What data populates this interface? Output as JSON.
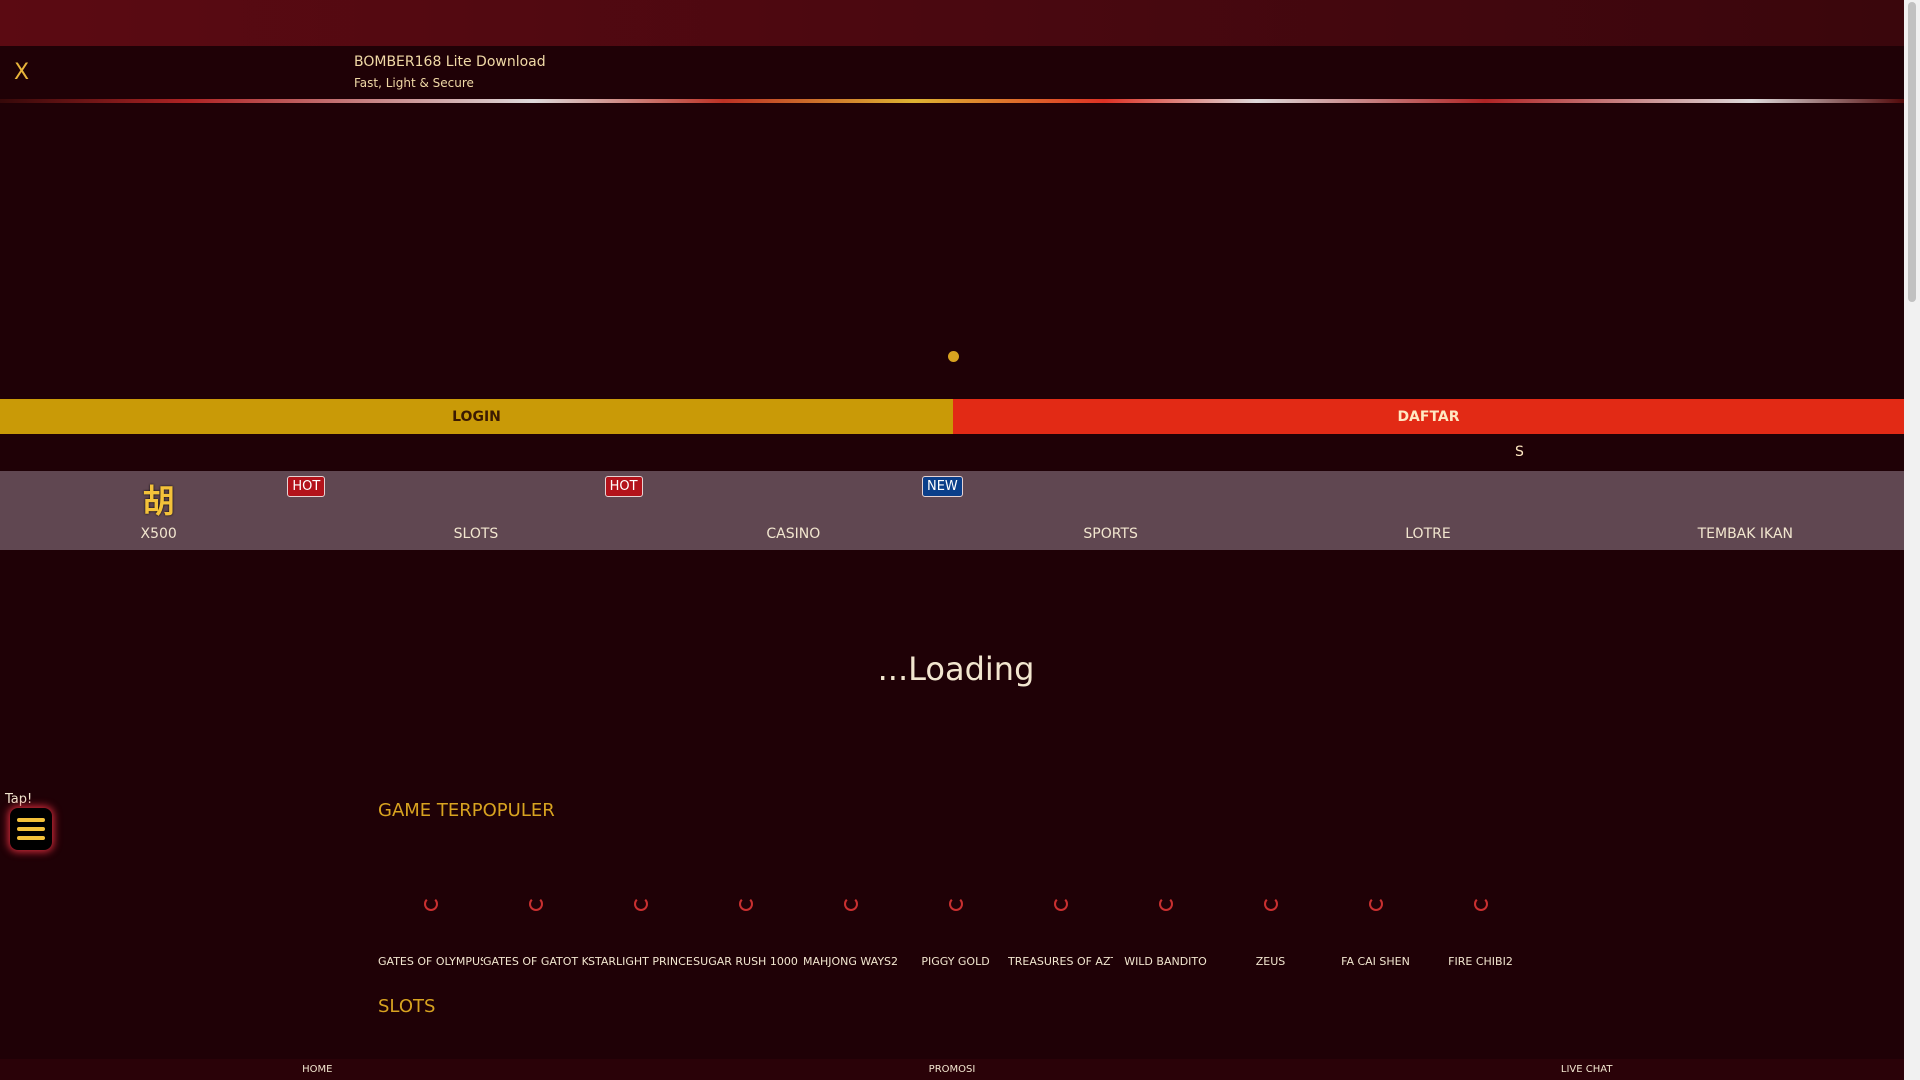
{
  "app_banner": {
    "close_label": "X",
    "title": "BOMBER168 Lite Download",
    "subtitle": "Fast, Light & Secure"
  },
  "carousel": {
    "active_slide": 1
  },
  "auth": {
    "login_label": "LOGIN",
    "daftar_label": "DAFTAR"
  },
  "marquee": {
    "text": "S"
  },
  "categories": [
    {
      "label": "X500",
      "badge": "",
      "icon": "x500-logo-icon"
    },
    {
      "label": "SLOTS",
      "badge": "HOT"
    },
    {
      "label": "CASINO",
      "badge": "HOT"
    },
    {
      "label": "SPORTS",
      "badge": "NEW"
    },
    {
      "label": "LOTRE",
      "badge": ""
    },
    {
      "label": "TEMBAK IKAN",
      "badge": ""
    }
  ],
  "loading_text": "...Loading",
  "floating_menu": {
    "tap_label": "Tap!",
    "icon": "hamburger-menu-icon"
  },
  "popular": {
    "title": "GAME TERPOPULER",
    "games": [
      "GATES OF OLYMPUS",
      "GATES OF GATOT KACA",
      "STARLIGHT PRINCESS",
      "SUGAR RUSH 1000",
      "MAHJONG WAYS2",
      "PIGGY GOLD",
      "TREASURES OF AZTEC",
      "WILD BANDITO",
      "ZEUS",
      "FA CAI SHEN",
      "FIRE CHIBI2"
    ]
  },
  "slots_section": {
    "title": "SLOTS"
  },
  "bottom_nav": {
    "home": "HOME",
    "promosi": "PROMOSI",
    "live_chat": "LIVE CHAT"
  },
  "colors": {
    "background": "#1f0106",
    "login": "#c99a07",
    "daftar": "#e22a15",
    "category_bar": "#604751",
    "accent": "#d8a320"
  }
}
